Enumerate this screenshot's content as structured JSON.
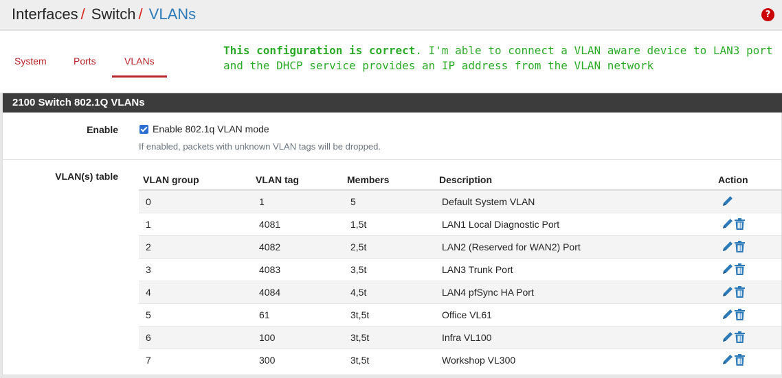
{
  "breadcrumb": {
    "items": [
      "Interfaces",
      "Switch",
      "VLANs"
    ],
    "separator": "/"
  },
  "help_icon": "?",
  "tabs": [
    {
      "label": "System"
    },
    {
      "label": "Ports"
    },
    {
      "label": "VLANs",
      "active": true
    }
  ],
  "note": {
    "bold": "This configuration is correct",
    "rest": ". I'm able to connect a VLAN aware device to LAN3 port and the DHCP service provides an IP address from the VLAN network"
  },
  "panel": {
    "title": "2100 Switch 802.1Q VLANs",
    "enable_label": "Enable",
    "checkbox_label": "Enable 802.1q VLAN mode",
    "checkbox_checked": true,
    "hint": "If enabled, packets with unknown VLAN tags will be dropped.",
    "table_label": "VLAN(s) table"
  },
  "table": {
    "headers": [
      "VLAN group",
      "VLAN tag",
      "Members",
      "Description",
      "Action"
    ],
    "rows": [
      {
        "group": "0",
        "tag": "1",
        "members": "5",
        "description": "Default System VLAN",
        "deletable": false
      },
      {
        "group": "1",
        "tag": "4081",
        "members": "1,5t",
        "description": "LAN1 Local Diagnostic Port",
        "deletable": true
      },
      {
        "group": "2",
        "tag": "4082",
        "members": "2,5t",
        "description": "LAN2 (Reserved for WAN2) Port",
        "deletable": true
      },
      {
        "group": "3",
        "tag": "4083",
        "members": "3,5t",
        "description": "LAN3 Trunk Port",
        "deletable": true
      },
      {
        "group": "4",
        "tag": "4084",
        "members": "4,5t",
        "description": "LAN4 pfSync HA Port",
        "deletable": true
      },
      {
        "group": "5",
        "tag": "61",
        "members": "3t,5t",
        "description": "Office VL61",
        "deletable": true
      },
      {
        "group": "6",
        "tag": "100",
        "members": "3t,5t",
        "description": "Infra VL100",
        "deletable": true
      },
      {
        "group": "7",
        "tag": "300",
        "members": "3t,5t",
        "description": "Workshop VL300",
        "deletable": true
      }
    ]
  },
  "colors": {
    "accent_link": "#2c7ab8",
    "tab_red": "#b7242a",
    "note_green": "#2cab28",
    "panel_header": "#3c3c3c",
    "icon_blue": "#2c7ab8"
  },
  "icons": {
    "edit": "pencil-icon",
    "delete": "trash-icon",
    "help": "help-icon"
  }
}
